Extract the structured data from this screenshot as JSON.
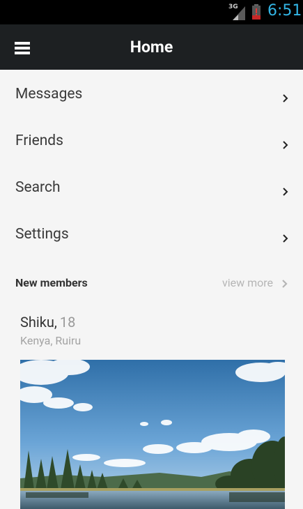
{
  "statusbar": {
    "network": "3G",
    "time": "6:51"
  },
  "appbar": {
    "title": "Home"
  },
  "nav": [
    {
      "label": "Messages"
    },
    {
      "label": "Friends"
    },
    {
      "label": "Search"
    },
    {
      "label": "Settings"
    }
  ],
  "section": {
    "title": "New members",
    "view_more": "view more"
  },
  "member": {
    "name": "Shiku,",
    "age": "18",
    "location": "Kenya, Ruiru"
  },
  "icons": {
    "menu": "hamburger-menu-icon",
    "chevron": "chevron-right-icon",
    "battery": "battery-alert-icon",
    "signal": "signal-icon"
  },
  "colors": {
    "accent": "#33b5e5",
    "appbar": "#1d2022",
    "background": "#f5f5f5"
  }
}
